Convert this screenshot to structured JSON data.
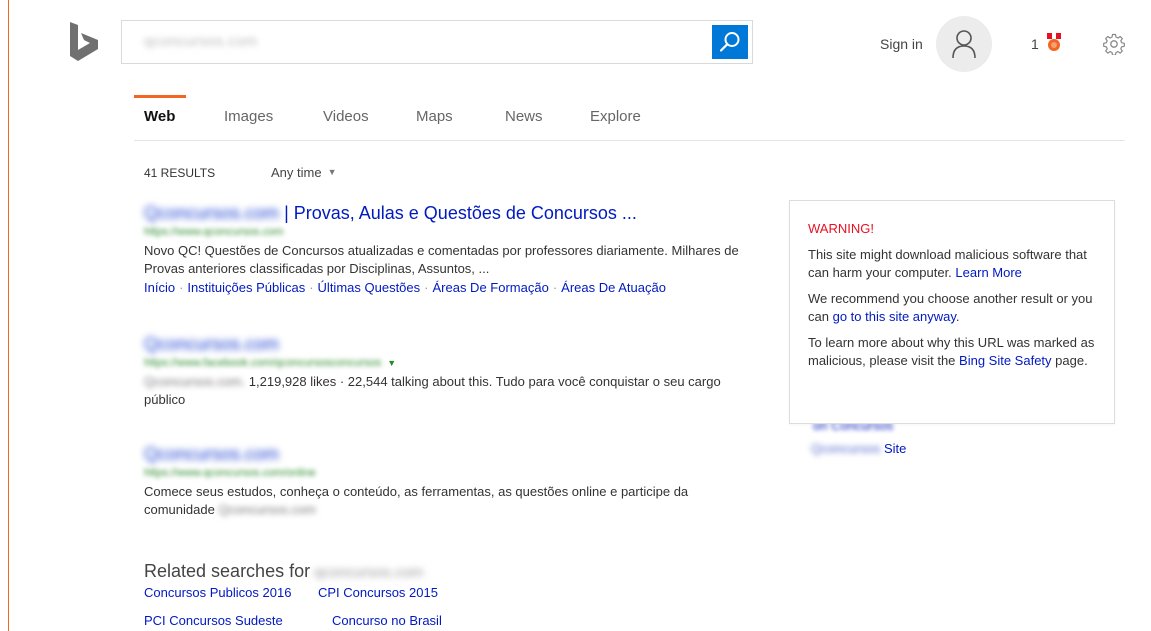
{
  "search": {
    "query": "qconcursos.com"
  },
  "header": {
    "sign_in": "Sign in",
    "rewards_count": "1"
  },
  "tabs": [
    {
      "label": "Web"
    },
    {
      "label": "Images"
    },
    {
      "label": "Videos"
    },
    {
      "label": "Maps"
    },
    {
      "label": "News"
    },
    {
      "label": "Explore"
    }
  ],
  "results_meta": {
    "count": "41 RESULTS",
    "time_filter": "Any time"
  },
  "results": [
    {
      "title_blurred": "Qconcursos.com",
      "title": "| Provas, Aulas e Questões de Concursos ...",
      "url": "https://www.qconcursos.com",
      "snippet": "Novo QC! Questões de Concursos atualizadas e comentadas por professores diariamente. Milhares de Provas anteriores classificadas por Disciplinas, Assuntos, ...",
      "deeplinks": [
        "Início",
        "Instituições Públicas",
        "Últimas Questões",
        "Áreas De Formação",
        "Áreas De Atuação"
      ]
    },
    {
      "title_blurred": "Qconcursos.com",
      "url": "https://www.facebook.com/qconcursosconcursos",
      "snippet_blurred": "Qconcursos.com.",
      "snippet": "1,219,928 likes · 22,544 talking about this. Tudo para você conquistar o seu cargo público"
    },
    {
      "title_blurred": "Qconcursos.com",
      "url": "https://www.qconcursos.com/online",
      "snippet": "Comece seus estudos, conheça o conteúdo, as ferramentas, as questões online e participe da comunidade",
      "snippet_blurred": "Qconcursos.com"
    }
  ],
  "related": {
    "heading": "Related searches for",
    "heading_blurred": "qconcursos.com",
    "items": [
      "Concursos Publicos 2016",
      "CPI Concursos 2015",
      "PCI Concursos Sudeste",
      "Concurso no Brasil"
    ]
  },
  "warning": {
    "heading": "WARNING!",
    "p1": "This site might download malicious software that can harm your computer.",
    "p1_link": "Learn More",
    "p2": "We recommend you choose another result or you can",
    "p2_link": "go to this site anyway",
    "p2_end": ".",
    "p3": "To learn more about why this URL was marked as malicious, please visit the",
    "p3_link": "Bing Site Safety",
    "p3_end": "page."
  },
  "sidebar": {
    "link_partial": "on Concursos",
    "site_blurred": "Qconcursos",
    "site_label": "Site"
  },
  "colors": {
    "accent_orange": "#f26522",
    "search_blue": "#0078d7",
    "link_blue": "#0019c1",
    "url_green": "#2a8a2a",
    "warning_red": "#e81123"
  },
  "icons": {
    "logo": "bing-logo-icon",
    "search": "search-icon",
    "avatar": "person-icon",
    "rewards": "medal-icon",
    "settings": "gear-icon",
    "dropdown": "caret-down-icon"
  }
}
